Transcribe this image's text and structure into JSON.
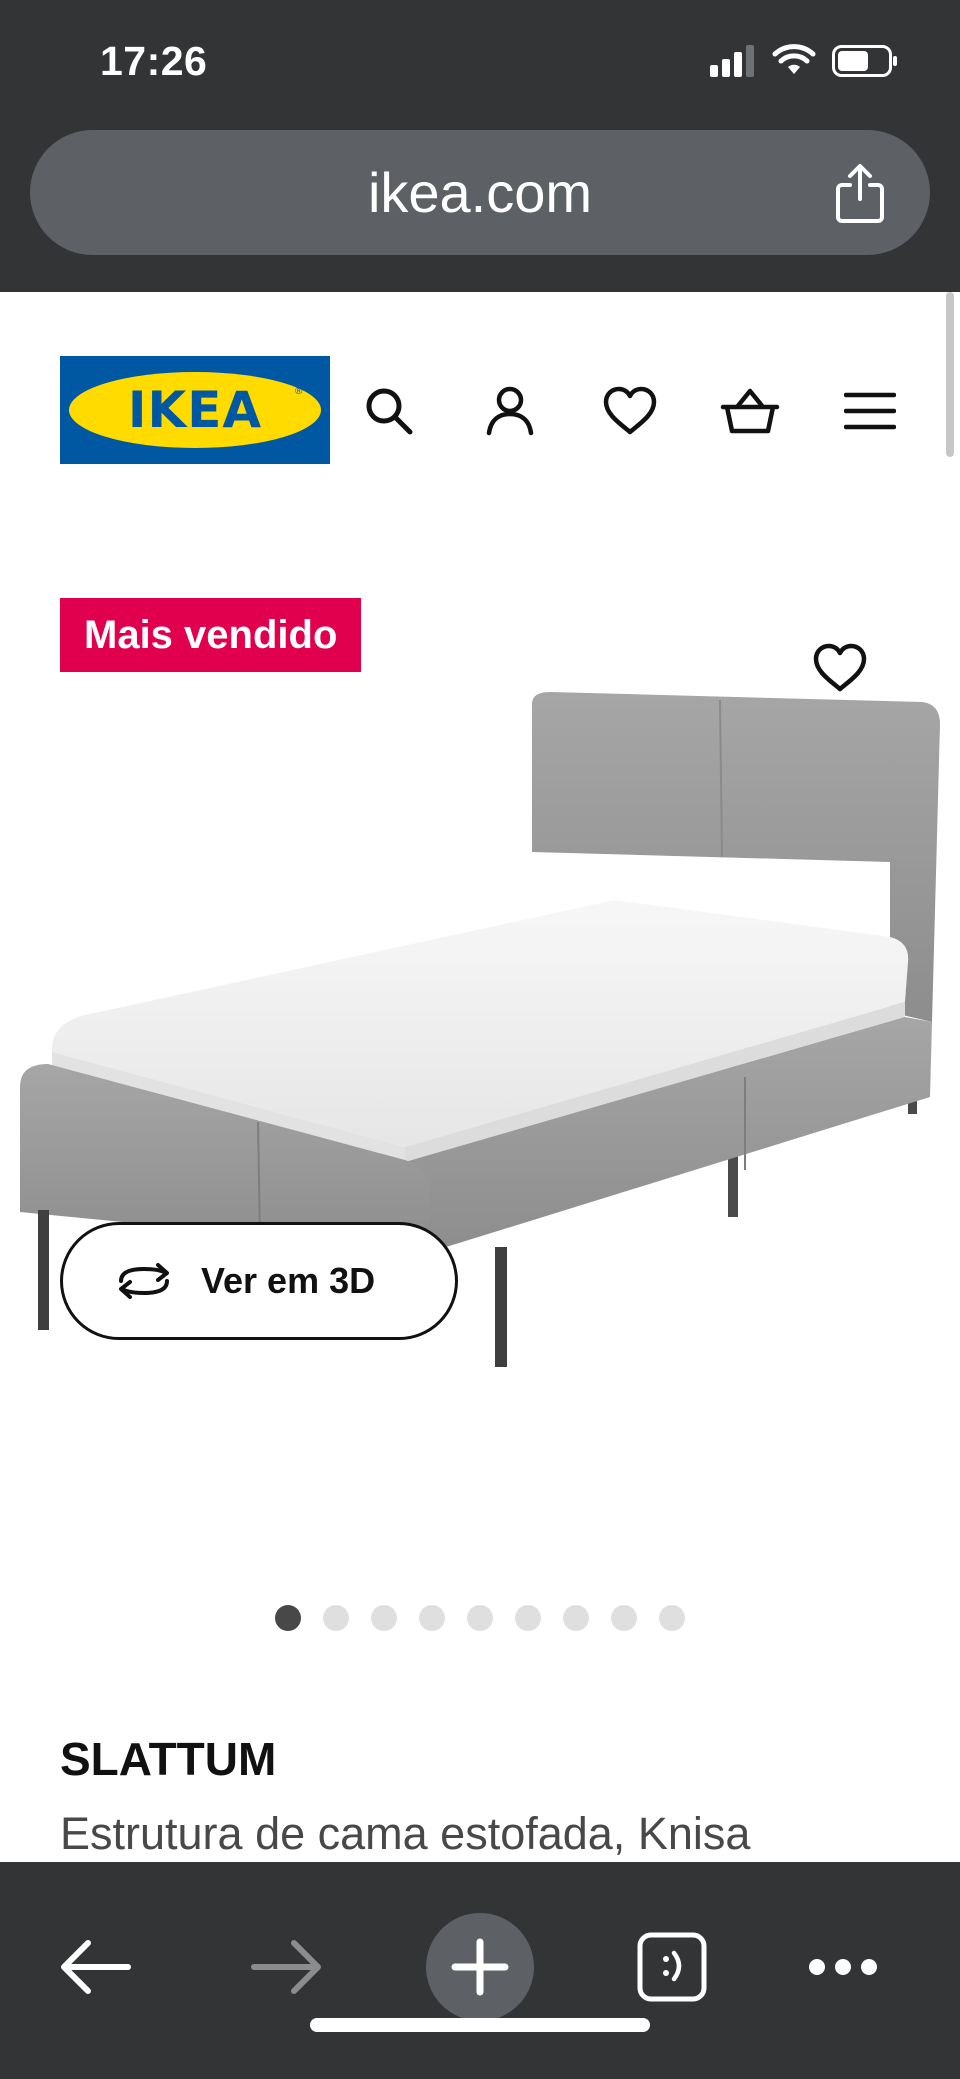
{
  "status_bar": {
    "time": "17:26",
    "icons": [
      "cellular-signal-icon",
      "wifi-icon",
      "battery-icon"
    ]
  },
  "browser": {
    "url": "ikea.com",
    "share_icon": "share-icon"
  },
  "site_header": {
    "logo_text": "IKEA",
    "logo_registered": "®",
    "icons": [
      "search-icon",
      "account-icon",
      "heart-icon",
      "basket-icon",
      "menu-icon"
    ]
  },
  "product": {
    "badge": "Mais vendido",
    "view_3d_label": "Ver em 3D",
    "name": "SLATTUM",
    "description": "Estrutura de cama estofada, Knisa",
    "gallery": {
      "total_images": 9,
      "active_index": 0
    }
  },
  "bottom_toolbar": {
    "icons": [
      "back-arrow-icon",
      "forward-arrow-icon",
      "new-tab-plus-icon",
      "tabs-icon",
      "more-options-icon"
    ]
  },
  "colors": {
    "browser_chrome": "#323436",
    "url_bar": "#5d6165",
    "ikea_blue": "#0058a3",
    "ikea_yellow": "#ffdb00",
    "badge_pink": "#e0004d",
    "fabric_grey": "#9a9a9a"
  }
}
